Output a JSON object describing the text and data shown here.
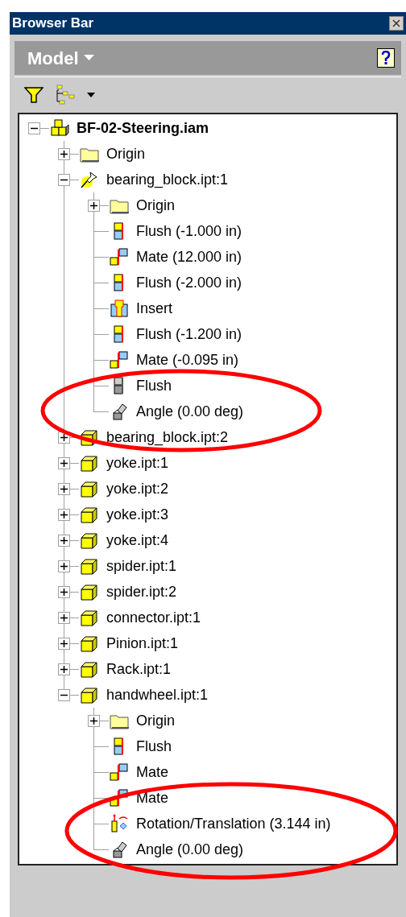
{
  "window": {
    "title": "Browser Bar"
  },
  "panel": {
    "label": "Model"
  },
  "tree": [
    {
      "label": "BF-02-Steering.iam",
      "kind": "assembly",
      "expanded": true,
      "children": [
        {
          "label": "Origin",
          "kind": "folder",
          "expanded": false
        },
        {
          "label": "bearing_block.ipt:1",
          "kind": "grounded-part",
          "expanded": true,
          "children": [
            {
              "label": "Origin",
              "kind": "folder",
              "expanded": false
            },
            {
              "label": "Flush (-1.000 in)",
              "kind": "flush"
            },
            {
              "label": "Mate (12.000 in)",
              "kind": "mate"
            },
            {
              "label": "Flush (-2.000 in)",
              "kind": "flush"
            },
            {
              "label": "Insert",
              "kind": "insert"
            },
            {
              "label": "Flush (-1.200 in)",
              "kind": "flush"
            },
            {
              "label": "Mate (-0.095 in)",
              "kind": "mate"
            },
            {
              "label": "Flush",
              "kind": "flush-suppressed"
            },
            {
              "label": "Angle (0.00 deg)",
              "kind": "angle"
            }
          ]
        },
        {
          "label": "bearing_block.ipt:2",
          "kind": "part",
          "expanded": false
        },
        {
          "label": "yoke.ipt:1",
          "kind": "part",
          "expanded": false
        },
        {
          "label": "yoke.ipt:2",
          "kind": "part",
          "expanded": false
        },
        {
          "label": "yoke.ipt:3",
          "kind": "part",
          "expanded": false
        },
        {
          "label": "yoke.ipt:4",
          "kind": "part",
          "expanded": false
        },
        {
          "label": "spider.ipt:1",
          "kind": "part",
          "expanded": false
        },
        {
          "label": "spider.ipt:2",
          "kind": "part",
          "expanded": false
        },
        {
          "label": "connector.ipt:1",
          "kind": "part",
          "expanded": false
        },
        {
          "label": "Pinion.ipt:1",
          "kind": "part",
          "expanded": false
        },
        {
          "label": "Rack.ipt:1",
          "kind": "part",
          "expanded": false
        },
        {
          "label": "handwheel.ipt:1",
          "kind": "part",
          "expanded": true,
          "children": [
            {
              "label": "Origin",
              "kind": "folder",
              "expanded": false
            },
            {
              "label": "Flush",
              "kind": "flush"
            },
            {
              "label": "Mate",
              "kind": "mate"
            },
            {
              "label": "Mate",
              "kind": "mate"
            },
            {
              "label": "Rotation/Translation (3.144 in)",
              "kind": "rotation"
            },
            {
              "label": "Angle (0.00 deg)",
              "kind": "angle"
            }
          ]
        }
      ]
    }
  ]
}
